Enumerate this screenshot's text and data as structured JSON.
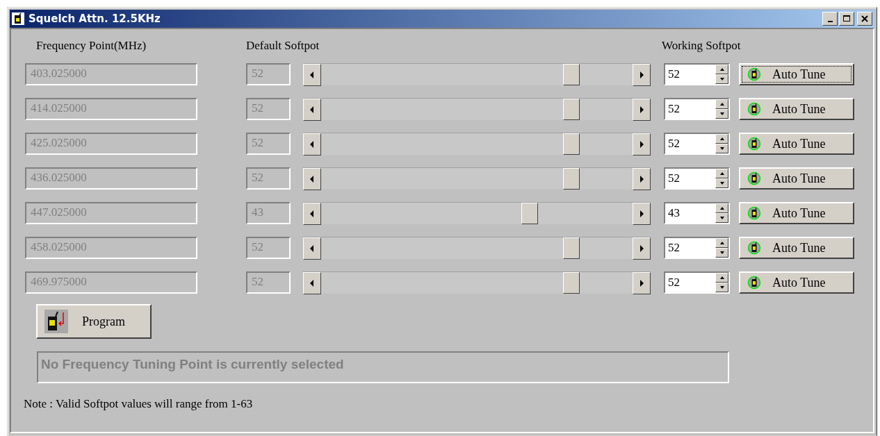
{
  "window": {
    "title": "Squelch Attn. 12.5KHz"
  },
  "headers": {
    "frequency": "Frequency Point(MHz)",
    "default": "Default Softpot",
    "working": "Working Softpot"
  },
  "rows": [
    {
      "frequency": "403.025000",
      "default": "52",
      "level": 0.82,
      "working": "52",
      "button": "Auto Tune",
      "focused": true
    },
    {
      "frequency": "414.025000",
      "default": "52",
      "level": 0.82,
      "working": "52",
      "button": "Auto Tune",
      "focused": false
    },
    {
      "frequency": "425.025000",
      "default": "52",
      "level": 0.82,
      "working": "52",
      "button": "Auto Tune",
      "focused": false
    },
    {
      "frequency": "436.025000",
      "default": "52",
      "level": 0.82,
      "working": "52",
      "button": "Auto Tune",
      "focused": false
    },
    {
      "frequency": "447.025000",
      "default": "43",
      "level": 0.68,
      "working": "43",
      "button": "Auto Tune",
      "focused": false
    },
    {
      "frequency": "458.025000",
      "default": "52",
      "level": 0.82,
      "working": "52",
      "button": "Auto Tune",
      "focused": false
    },
    {
      "frequency": "469.975000",
      "default": "52",
      "level": 0.82,
      "working": "52",
      "button": "Auto Tune",
      "focused": false
    }
  ],
  "program_button": "Program",
  "status": "No Frequency Tuning Point is currently selected",
  "note": "Note : Valid Softpot values will range from 1-63"
}
